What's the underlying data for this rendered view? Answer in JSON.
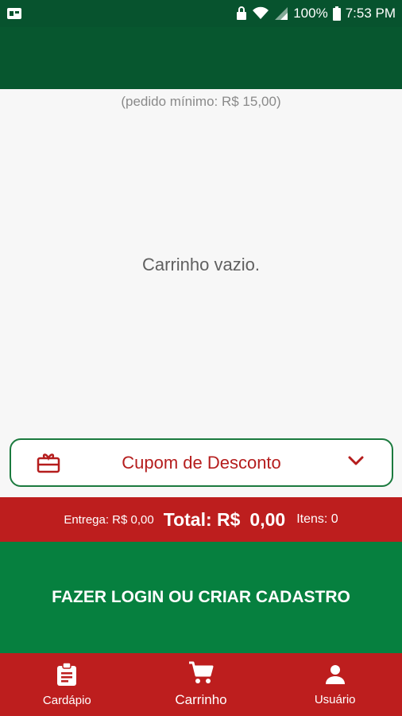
{
  "status_bar": {
    "battery": "100%",
    "time": "7:53 PM"
  },
  "cart": {
    "minimum_order": "(pedido mínimo: R$ 15,00)",
    "empty_message": "Carrinho vazio."
  },
  "coupon": {
    "label": "Cupom de Desconto"
  },
  "totals": {
    "delivery": "Entrega: R$ 0,00",
    "total_label": "Total: R$",
    "total_value": "0,00",
    "items": "Itens: 0"
  },
  "login_button": {
    "label": "FAZER LOGIN OU CRIAR CADASTRO"
  },
  "bottom_nav": {
    "items": [
      {
        "label": "Cardápio",
        "icon": "clipboard-icon"
      },
      {
        "label": "Carrinho",
        "icon": "cart-icon"
      },
      {
        "label": "Usuário",
        "icon": "user-icon"
      }
    ]
  },
  "colors": {
    "header_green": "#07572f",
    "button_green": "#06803f",
    "accent_red": "#bd1e1e"
  }
}
